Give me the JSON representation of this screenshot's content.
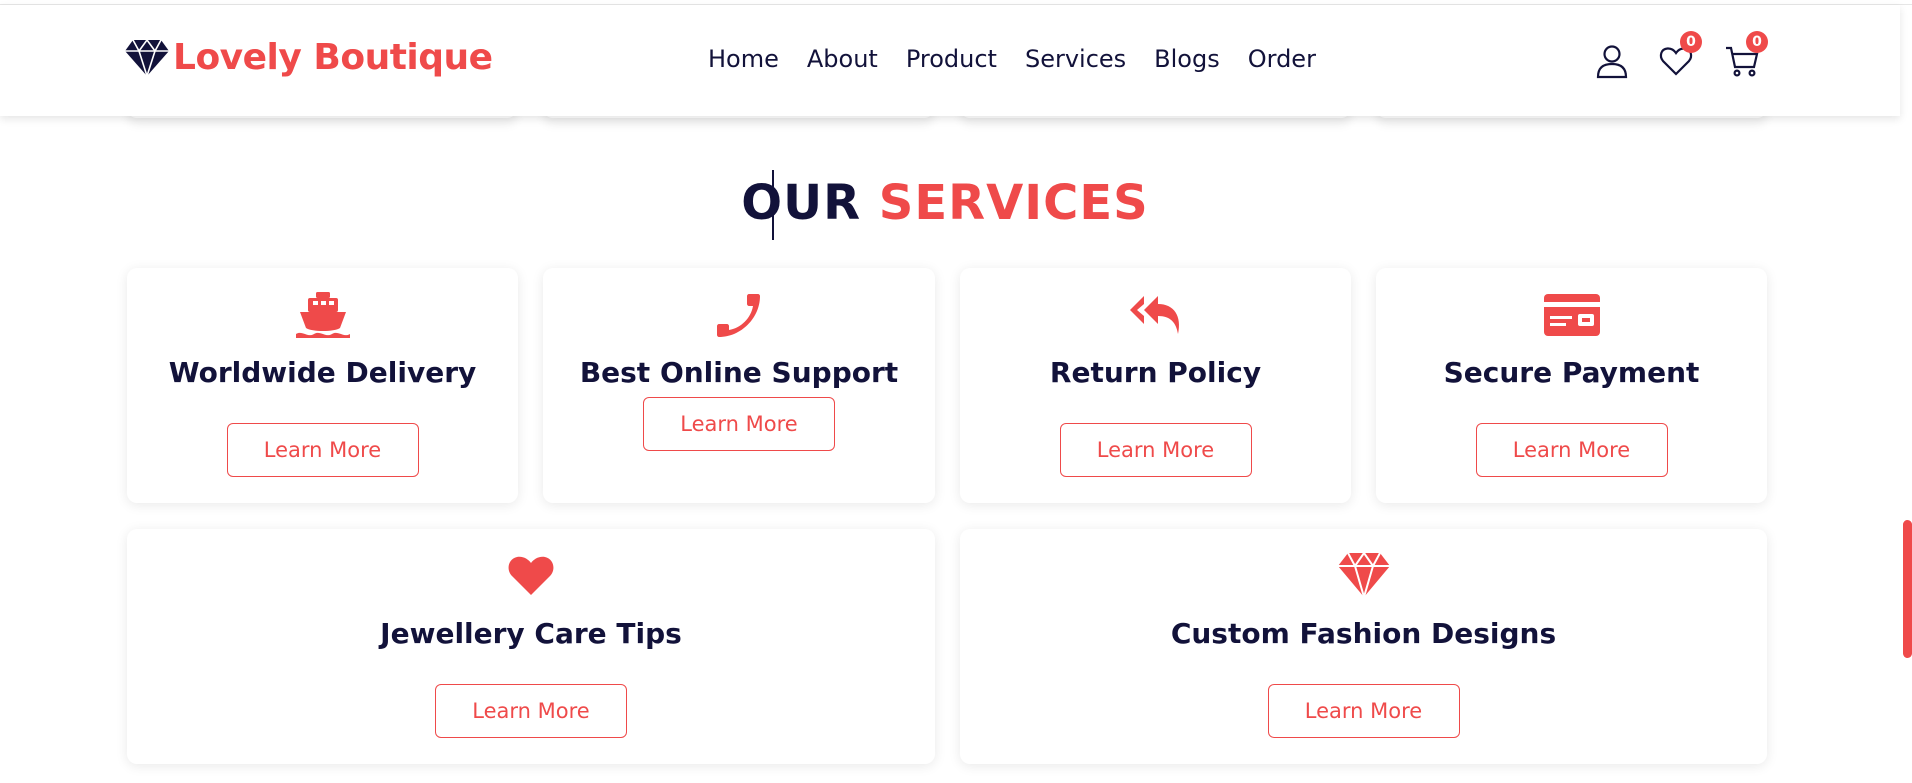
{
  "brand": {
    "name": "Lovely Boutique",
    "accent": "#ef4a4a",
    "dark": "#12123a"
  },
  "nav": [
    "Home",
    "About",
    "Product",
    "Services",
    "Blogs",
    "Order"
  ],
  "header_icons": {
    "user": "user-icon",
    "wishlist": {
      "icon": "heart-icon",
      "count": "0"
    },
    "cart": {
      "icon": "cart-icon",
      "count": "0"
    }
  },
  "section": {
    "title_part1": "OUR",
    "title_part2": "SERVICES"
  },
  "services": [
    {
      "title": "Worldwide Delivery",
      "icon": "ship-icon",
      "button": "Learn More"
    },
    {
      "title": "Best Online Support",
      "icon": "phone-icon",
      "button": "Learn More"
    },
    {
      "title": "Return Policy",
      "icon": "reply-all-icon",
      "button": "Learn More"
    },
    {
      "title": "Secure Payment",
      "icon": "credit-card-icon",
      "button": "Learn More"
    },
    {
      "title": "Jewellery Care Tips",
      "icon": "heart-icon",
      "button": "Learn More"
    },
    {
      "title": "Custom Fashion Designs",
      "icon": "gem-icon",
      "button": "Learn More"
    }
  ]
}
